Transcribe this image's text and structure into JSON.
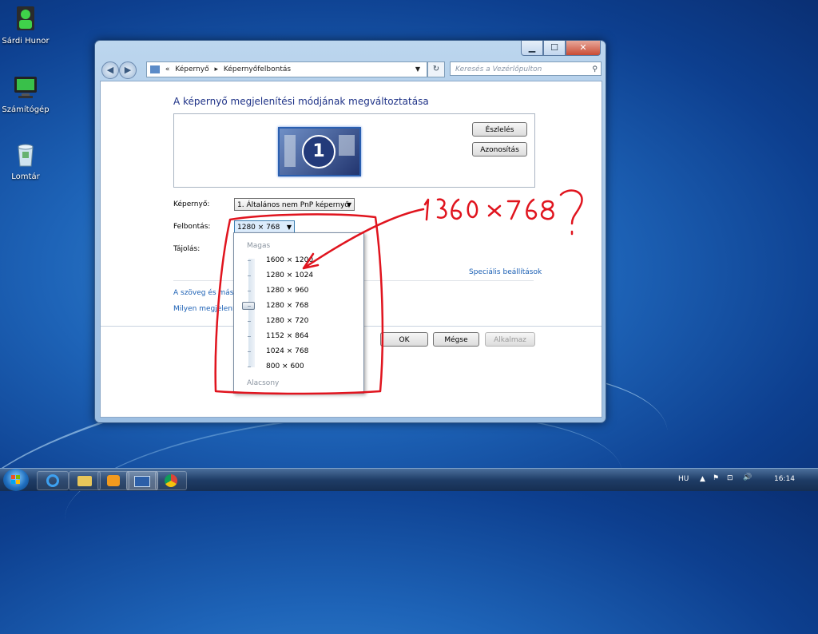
{
  "desktop": {
    "icons": [
      {
        "label": "Sárdi Hunor"
      },
      {
        "label": "Számítógép"
      },
      {
        "label": "Lomtár"
      }
    ]
  },
  "window": {
    "controls": {
      "minimize": "▁",
      "maximize": "☐",
      "close": "✕"
    },
    "breadcrumb": {
      "prefix": "«",
      "item1": "Képernyő",
      "sep": "▸",
      "item2": "Képernyőfelbontás"
    },
    "search_placeholder": "Keresés a Vezérlőpulton",
    "heading": "A képernyő megjelenítési módjának megváltoztatása",
    "monitor_number": "1",
    "detect_label": "Észlelés",
    "identify_label": "Azonosítás",
    "display_label": "Képernyő:",
    "display_value": "1. Általános nem PnP képernyő",
    "resolution_label": "Felbontás:",
    "resolution_value": "1280 × 768",
    "orientation_label": "Tájolás:",
    "advanced_link": "Speciális beállítások",
    "text_link": "A szöveg és más e",
    "which_link": "Milyen megjelenít",
    "ok_label": "OK",
    "cancel_label": "Mégse",
    "apply_label": "Alkalmaz"
  },
  "resolution_dropdown": {
    "top_caption": "Magas",
    "bottom_caption": "Alacsony",
    "options": [
      "1600 × 1200",
      "1280 × 1024",
      "1280 × 960",
      "1280 × 768",
      "1280 × 720",
      "1152 × 864",
      "1024 × 768",
      "800 × 600"
    ],
    "selected": "1280 × 768"
  },
  "annotation": {
    "handwritten": "1360 × 768 ?",
    "color": "#e0141e"
  },
  "taskbar": {
    "language": "HU",
    "clock": "16:14"
  }
}
